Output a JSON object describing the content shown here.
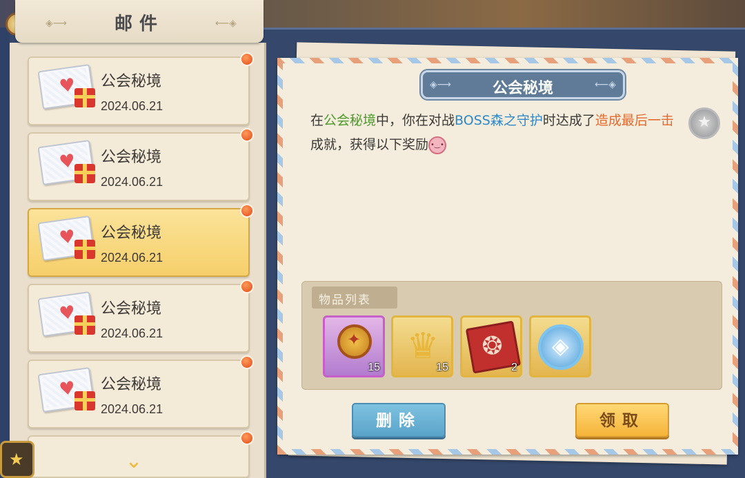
{
  "header": {
    "title": "邮件"
  },
  "mail_list": [
    {
      "name": "公会秘境",
      "date": "2024.06.21",
      "unread": true,
      "selected": false
    },
    {
      "name": "公会秘境",
      "date": "2024.06.21",
      "unread": true,
      "selected": false
    },
    {
      "name": "公会秘境",
      "date": "2024.06.21",
      "unread": true,
      "selected": true
    },
    {
      "name": "公会秘境",
      "date": "2024.06.21",
      "unread": true,
      "selected": false
    },
    {
      "name": "公会秘境",
      "date": "2024.06.21",
      "unread": true,
      "selected": false
    }
  ],
  "mail_detail": {
    "subject": "公会秘境",
    "body_parts": [
      "在",
      "公会秘境",
      "中，你在对战",
      "BOSS森之守护",
      "时达成了",
      "造成最后一击",
      "成就，获得以下奖励"
    ],
    "items_label": "物品列表",
    "items": [
      {
        "icon": "medal-icon",
        "quantity": "15",
        "rarity": "purple"
      },
      {
        "icon": "crown-icon",
        "quantity": "15",
        "rarity": "gold"
      },
      {
        "icon": "red-book-icon",
        "quantity": "2",
        "rarity": "gold"
      },
      {
        "icon": "compass-icon",
        "quantity": "",
        "rarity": "gold"
      }
    ]
  },
  "buttons": {
    "delete": "删除",
    "claim": "领取"
  },
  "colors": {
    "highlight_green": "#4c9b2a",
    "highlight_blue": "#2f88c9",
    "highlight_orange": "#e46a2c",
    "selected_item": "#f6cf6a"
  }
}
